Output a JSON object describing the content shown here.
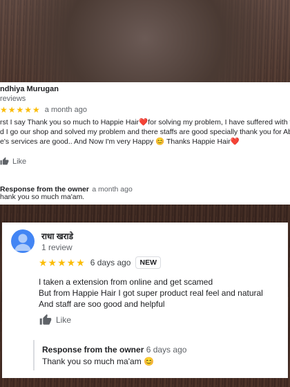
{
  "review1": {
    "reviewer_name": "ndhiya Murugan",
    "reviewer_meta": "reviews",
    "stars": "★★★★★",
    "time": "a month ago",
    "lines": [
      "rst I say Thank you so much to Happie Hair❤️for solving my problem, I have suffered with thin",
      "d I go our shop and solved my problem and there staffs are good specially thank you for Abir",
      "e's services are good..   And Now I'm very Happy  😊 Thanks Happie Hair❤️"
    ],
    "like_label": "Like",
    "owner_response_title": "Response from the owner",
    "owner_response_time": "a month ago",
    "owner_response_text": "hank you so much ma'am."
  },
  "review2": {
    "reviewer_name": "राधा खराडे",
    "reviewer_meta": "1 review",
    "stars": "★★★★★",
    "time": "6 days ago",
    "badge": "NEW",
    "lines": [
      "I taken a extension from online and get scamed",
      "But from Happie Hair I got super product real feel and natural",
      "And staff are soo good and helpful"
    ],
    "like_label": "Like",
    "owner_response_title": "Response from the owner",
    "owner_response_time": "6 days ago",
    "owner_response_text": "Thank you so much ma'am 😊"
  },
  "colors": {
    "star": "#fbbc04",
    "avatar": "#4285f4",
    "text": "#202124",
    "muted": "#5f6368"
  }
}
